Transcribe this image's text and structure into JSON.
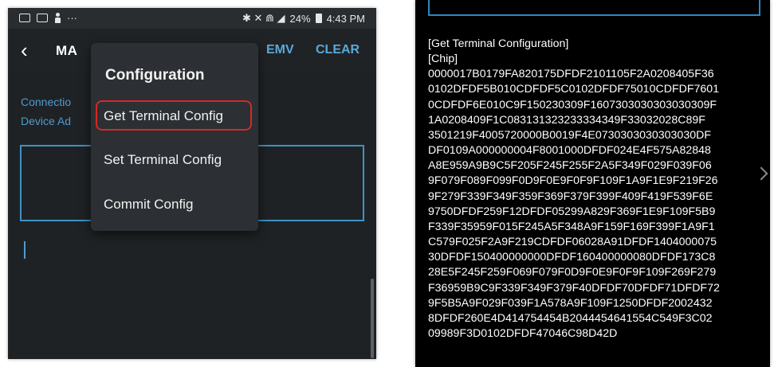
{
  "status_bar": {
    "dots": "···",
    "right_icons": "✱ ✕ ⋒ ◢",
    "battery_text": "24%",
    "time": "4:43 PM"
  },
  "toolbar": {
    "back_icon": "‹",
    "title": "MA",
    "emv_label": "EMV",
    "clear_label": "CLEAR"
  },
  "content": {
    "connection_label": "Connectio",
    "device_address_label": "Device Ad"
  },
  "menu": {
    "title": "Configuration",
    "items": [
      {
        "label": "Get Terminal Config"
      },
      {
        "label": "Set Terminal Config"
      },
      {
        "label": "Commit Config"
      }
    ]
  },
  "log": {
    "lines": [
      "[Get Terminal Configuration]",
      "[Chip]",
      "0000017B0179FA820175DFDF2101105F2A0208405F36",
      "0102DFDF5B010CDFDF5C0102DFDF75010CDFDF7601",
      "0CDFDF6E010C9F150230309F1607303030303030309F",
      "1A0208409F1C083131323233334349F33032028C89F",
      "3501219F4005720000B0019F4E0730303030303030DF",
      "DF0109A000000004F8001000DFDF024E4F575A82848",
      "A8E959A9B9C5F205F245F255F2A5F349F029F039F06",
      "9F079F089F099F0D9F0E9F0F9F109F1A9F1E9F219F26",
      "9F279F339F349F359F369F379F399F409F419F539F6E",
      "9750DFDF259F12DFDF05299A829F369F1E9F109F5B9",
      "F339F35959F015F245A5F348A9F159F169F399F1A9F1",
      "C579F025F2A9F219CDFDF06028A91DFDF1404000075",
      "30DFDF150400000000DFDF160400000080DFDF173C8",
      "28E5F245F259F069F079F0D9F0E9F0F9F109F269F279",
      "F36959B9C9F339F349F379F40DFDF70DFDF71DFDF72",
      "9F5B5A9F029F039F1A578A9F109F1250DFDF2002432",
      "8DFDF260E4D414754454B2044454641554C549F3C02",
      "09989F3D0102DFDF47046C98D42D"
    ]
  },
  "colors": {
    "accent": "#4d9bd1",
    "highlight": "#d62828",
    "panel_bg": "#1f2225",
    "log_bg": "#000000"
  }
}
